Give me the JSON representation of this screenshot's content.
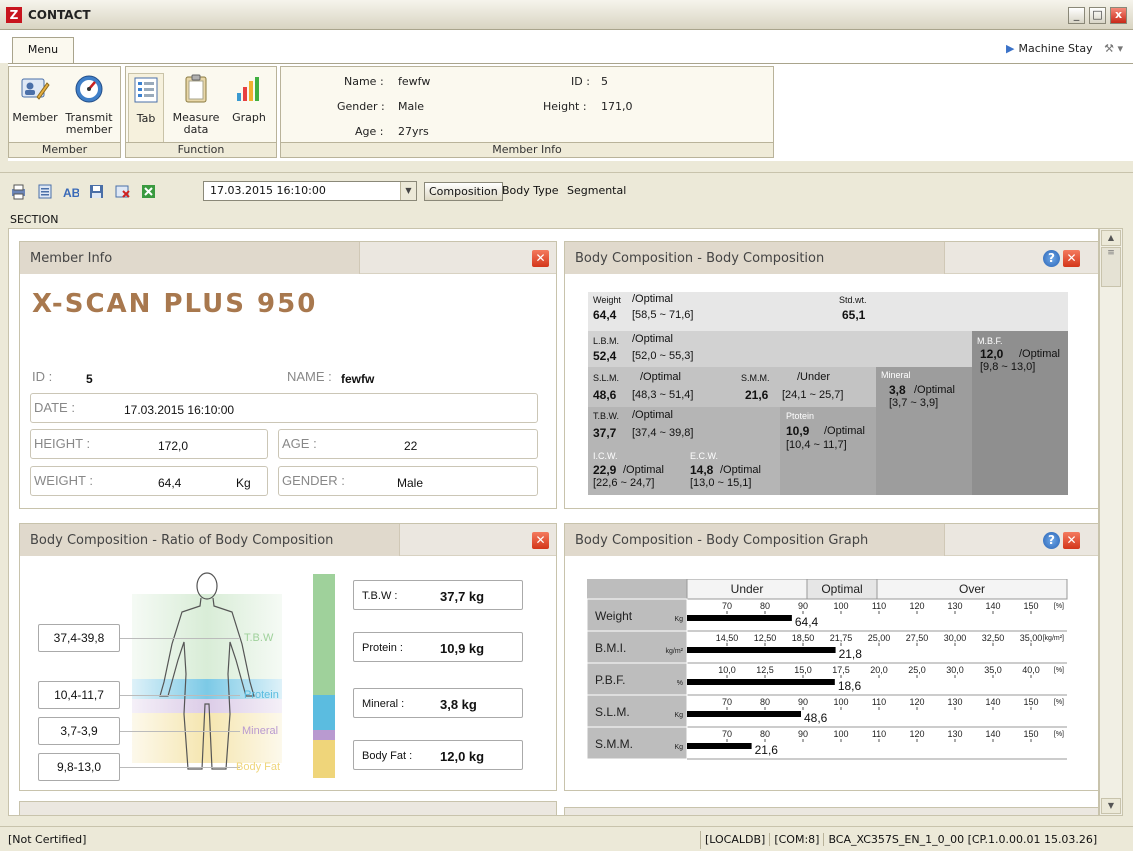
{
  "window": {
    "title": "CONTACT",
    "logo": "Z"
  },
  "menu": {
    "tab": "Menu",
    "machine_stay": "Machine Stay"
  },
  "ribbon": {
    "member_group": {
      "caption": "Member",
      "buttons": [
        {
          "label": "Member"
        },
        {
          "label": "Transmit member"
        }
      ]
    },
    "function_group": {
      "caption": "Function",
      "buttons": [
        {
          "label": "Tab"
        },
        {
          "label": "Measure data"
        },
        {
          "label": "Graph"
        }
      ]
    },
    "member_info": {
      "caption": "Member Info",
      "name_label": "Name :",
      "name": "fewfw",
      "gender_label": "Gender :",
      "gender": "Male",
      "age_label": "Age :",
      "age": "27yrs",
      "id_label": "ID :",
      "id": "5",
      "height_label": "Height :",
      "height": "171,0"
    }
  },
  "toolbar": {
    "date_select": "17.03.2015 16:10:00",
    "views": [
      "Composition",
      "Body Type",
      "Segmental"
    ],
    "section": "SECTION"
  },
  "panel_member": {
    "title": "Member Info",
    "device": "X-SCAN PLUS 950",
    "id_label": "ID :",
    "id": "5",
    "name_label": "NAME :",
    "name": "fewfw",
    "date_label": "DATE :",
    "date": "17.03.2015 16:10:00",
    "height_label": "HEIGHT :",
    "height": "172,0",
    "age_label": "AGE :",
    "age": "22",
    "weight_label": "WEIGHT :",
    "weight": "64,4",
    "weight_unit": "Kg",
    "gender_label": "GENDER :",
    "gender": "Male"
  },
  "panel_bodycomp": {
    "title": "Body Composition - Body Composition",
    "weight": {
      "label": "Weight",
      "status": "/Optimal",
      "value": "64,4",
      "range": "[58,5 ~ 71,6]"
    },
    "stdwt": {
      "label": "Std.wt.",
      "value": "65,1"
    },
    "lbm": {
      "label": "L.B.M.",
      "status": "/Optimal",
      "value": "52,4",
      "range": "[52,0 ~ 55,3]"
    },
    "mbf": {
      "label": "M.B.F.",
      "value": "12,0",
      "status": "/Optimal",
      "range": "[9,8 ~ 13,0]"
    },
    "slm": {
      "label": "S.L.M.",
      "status": "/Optimal",
      "value": "48,6",
      "range": "[48,3 ~ 51,4]"
    },
    "smm": {
      "label": "S.M.M.",
      "status": "/Under",
      "value": "21,6",
      "range": "[24,1 ~ 25,7]"
    },
    "mineral": {
      "label": "Mineral",
      "value": "3,8",
      "status": "/Optimal",
      "range": "[3,7 ~ 3,9]"
    },
    "tbw": {
      "label": "T.B.W.",
      "status": "/Optimal",
      "value": "37,7",
      "range": "[37,4 ~ 39,8]"
    },
    "protein": {
      "label": "Ptotein",
      "value": "10,9",
      "status": "/Optimal",
      "range": "[10,4 ~ 11,7]"
    },
    "icw": {
      "label": "I.C.W.",
      "value": "22,9",
      "status": "/Optimal",
      "range": "[22,6 ~ 24,7]"
    },
    "ecw": {
      "label": "E.C.W.",
      "value": "14,8",
      "status": "/Optimal",
      "range": "[13,0 ~ 15,1]"
    }
  },
  "panel_ratio": {
    "title": "Body Composition - Ratio of Body Composition",
    "ranges": [
      "37,4-39,8",
      "10,4-11,7",
      "3,7-3,9",
      "9,8-13,0"
    ],
    "labels": [
      "T.B.W",
      "Protein",
      "Mineral",
      "Body Fat"
    ],
    "label_colors": [
      "#9fd19b",
      "#5bbce0",
      "#b99ad0",
      "#efd57a"
    ],
    "bar_fractions": [
      0.588,
      0.17,
      0.05,
      0.187
    ],
    "values": [
      {
        "label": "T.B.W :",
        "value": "37,7 kg"
      },
      {
        "label": "Protein :",
        "value": "10,9 kg"
      },
      {
        "label": "Mineral :",
        "value": "3,8 kg"
      },
      {
        "label": "Body Fat :",
        "value": "12,0 kg"
      }
    ]
  },
  "panel_graph": {
    "title": "Body Composition - Body Composition Graph",
    "headers": [
      "Under",
      "Optimal",
      "Over"
    ],
    "rows": [
      {
        "name": "Weight",
        "unit": "Kg",
        "ticks": [
          "70",
          "80",
          "90",
          "100",
          "110",
          "120",
          "130",
          "140",
          "150"
        ],
        "suffix": "[%]",
        "value": "64,4",
        "fraction": 0.276
      },
      {
        "name": "B.M.I.",
        "unit": "kg/m²",
        "ticks": [
          "14,50",
          "12,50",
          "18,50",
          "21,75",
          "25,00",
          "27,50",
          "30,00",
          "32,50",
          "35,00"
        ],
        "suffix": "[kg/m²]",
        "value": "21,8",
        "fraction": 0.391
      },
      {
        "name": "P.B.F.",
        "unit": "%",
        "ticks": [
          "10,0",
          "12,5",
          "15,0",
          "17,5",
          "20,0",
          "25,0",
          "30,0",
          "35,0",
          "40,0"
        ],
        "suffix": "[%]",
        "value": "18,6",
        "fraction": 0.389
      },
      {
        "name": "S.L.M.",
        "unit": "Kg",
        "ticks": [
          "70",
          "80",
          "90",
          "100",
          "110",
          "120",
          "130",
          "140",
          "150"
        ],
        "suffix": "[%]",
        "value": "48,6",
        "fraction": 0.3
      },
      {
        "name": "S.M.M.",
        "unit": "Kg",
        "ticks": [
          "70",
          "80",
          "90",
          "100",
          "110",
          "120",
          "130",
          "140",
          "150"
        ],
        "suffix": "[%]",
        "value": "21,6",
        "fraction": 0.17
      }
    ]
  },
  "status": {
    "left": "[Not Certified]",
    "items": [
      "[LOCALDB]",
      "[COM:8]",
      "BCA_XC357S_EN_1_0_00 [CP.1.0.00.01 15.03.26]"
    ]
  }
}
